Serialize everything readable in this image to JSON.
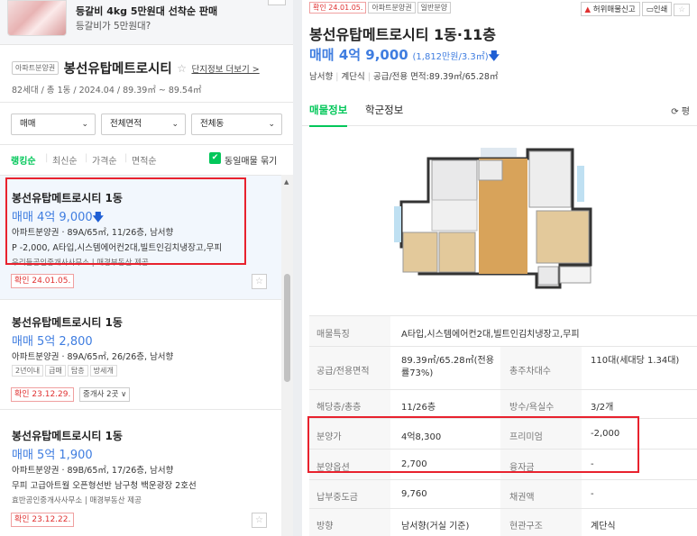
{
  "ad": {
    "title": "등갈비 4kg 5만원대 선착순 판매",
    "subtitle": "등갈비가 5만원대?"
  },
  "complex": {
    "tag": "아파트분양권",
    "name": "봉선유탑메트로시티",
    "star": "☆",
    "info_link": "단지정보 더보기 >",
    "meta": "82세대 / 총 1동 / 2024.04 / 89.39㎡ ~ 89.54㎡"
  },
  "filters": [
    {
      "label": "매매"
    },
    {
      "label": "전체면적"
    },
    {
      "label": "전체동"
    }
  ],
  "sort": {
    "options": [
      "랭킹순",
      "최신순",
      "가격순",
      "면적순"
    ],
    "same_listing_label": "동일매물 묶기",
    "checked_mark": "✔"
  },
  "listings": [
    {
      "title": "봉선유탑메트로시티 1동",
      "price": "매매 4억 9,000",
      "price_arrow": "🡇",
      "detail": "아파트분양권 · 89A/65㎡, 11/26층, 남서향",
      "desc": "P -2,000, A타입,시스템에어컨2대,빌트인김치냉장고,무피",
      "agent": "우리들공인중개사사무소 | 매경부동산 제공",
      "confirm": "확인 24.01.05."
    },
    {
      "title": "봉선유탑메트로시티 1동",
      "price": "매매 5억 2,800",
      "detail": "아파트분양권 · 89A/65㎡, 26/26층, 남서향",
      "chips": [
        "2년이내",
        "급매",
        "탑층",
        "방세개"
      ],
      "confirm": "확인 23.12.29.",
      "agent_btn": "중개사 2곳 ∨"
    },
    {
      "title": "봉선유탑메트로시티 1동",
      "price": "매매 5억 1,900",
      "detail": "아파트분양권 · 89B/65㎡, 17/26층, 남서향",
      "desc": "무피 고급아트월 오픈형선반 남구청 백운광장 2호선",
      "agent": "효반공인중개사사무소 | 매경부동산 제공",
      "confirm": "확인 23.12.22."
    }
  ],
  "fav_icon": "☆",
  "detail": {
    "badges": [
      "확인 24.01.05.",
      "아파트분양권",
      "일반분양"
    ],
    "report_label": "허위매물신고",
    "print_label": "인쇄",
    "title": "봉선유탑메트로시티 1동·11층",
    "price_main": "매매 4억 9,000",
    "price_unit": "(1,812만원/3.3㎡)",
    "price_arrow": "🡇",
    "sub": [
      "남서향",
      "계단식",
      "공급/전용 면적:89.39㎡/65.28㎡"
    ],
    "tabs": [
      "매물정보",
      "학군정보"
    ],
    "tab_right": "⟳ 평",
    "rows": [
      {
        "h": "매물특징",
        "v": "A타입,시스템에어컨2대,빌트인김치냉장고,무피"
      },
      {
        "h": "공급/전용면적",
        "v": "89.39㎡/65.28㎡(전용률73%)",
        "h2": "총주차대수",
        "v2": "110대(세대당 1.34대)"
      },
      {
        "h": "해당층/총층",
        "v": "11/26층",
        "h2": "방수/욕실수",
        "v2": "3/2개"
      },
      {
        "h": "분양가",
        "v": "4억8,300",
        "h2": "프리미엄",
        "v2": "-2,000"
      },
      {
        "h": "분양옵션",
        "v": "2,700",
        "h2": "융자금",
        "v2": "-"
      },
      {
        "h": "납부중도금",
        "v": "9,760",
        "h2": "채권액",
        "v2": "-"
      },
      {
        "h": "방향",
        "v": "남서향(거실 기준)",
        "h2": "현관구조",
        "v2": "계단식"
      }
    ]
  },
  "colors": {
    "accent_green": "#03c75a",
    "price_blue": "#3f7de0",
    "highlight_red": "#e8222e"
  }
}
